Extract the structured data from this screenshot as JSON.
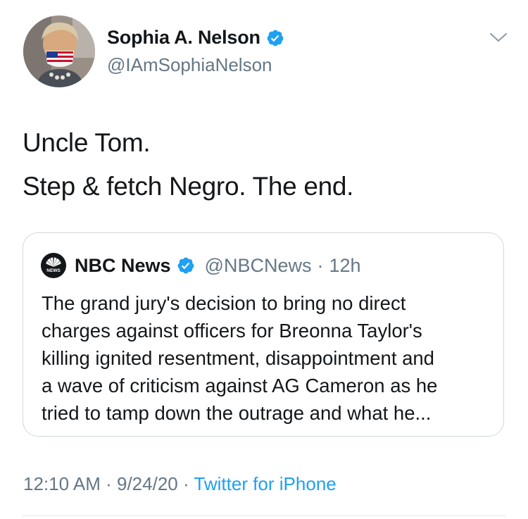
{
  "author": {
    "display_name": "Sophia A. Nelson",
    "handle": "@IAmSophiaNelson",
    "verified": true
  },
  "tweet": {
    "lines": [
      "Uncle Tom.",
      "Step & fetch Negro. The end."
    ]
  },
  "quoted_tweet": {
    "logo_text": "NEWS",
    "display_name": "NBC News",
    "handle": "@NBCNews",
    "separator": "·",
    "time": "12h",
    "text_lines": [
      "The grand jury's decision to bring no direct",
      "charges against officers for Breonna Taylor's",
      "killing ignited resentment, disappointment and",
      "a wave of criticism against AG Cameron as he",
      "tried to tamp down the outrage and what he..."
    ]
  },
  "meta": {
    "time": "12:10 AM",
    "dot1": "·",
    "date": "9/24/20",
    "dot2": "·",
    "source": "Twitter for iPhone"
  },
  "colors": {
    "text": "#14171a",
    "secondary": "#657786",
    "accent": "#1da1f2",
    "border": "#cfd9de"
  },
  "icons": {
    "verified": "verified-badge-icon",
    "caret": "chevron-down-icon",
    "nbc": "nbc-peacock-logo"
  }
}
